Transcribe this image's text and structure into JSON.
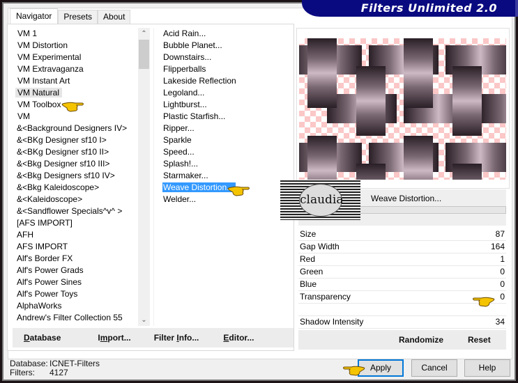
{
  "window": {
    "title": "Filters Unlimited 2.0"
  },
  "tabs": [
    {
      "label": "Navigator",
      "active": true
    },
    {
      "label": "Presets",
      "active": false
    },
    {
      "label": "About",
      "active": false
    }
  ],
  "categories": {
    "selected": "VM Natural",
    "items": [
      "VM 1",
      "VM Distortion",
      "VM Experimental",
      "VM Extravaganza",
      "VM Instant Art",
      "VM Natural",
      "VM Toolbox",
      "VM",
      "&<Background Designers IV>",
      "&<BKg Designer sf10 I>",
      "&<BKg Designer sf10 II>",
      "&<Bkg Designer sf10 III>",
      "&<Bkg Designers sf10 IV>",
      "&<Bkg Kaleidoscope>",
      "&<Kaleidoscope>",
      "&<Sandflower Specials^v^ >",
      "[AFS IMPORT]",
      "AFH",
      "AFS IMPORT",
      "Alf's Border FX",
      "Alf's Power Grads",
      "Alf's Power Sines",
      "Alf's Power Toys",
      "AlphaWorks",
      "Andrew's Filter Collection 55"
    ]
  },
  "filters": {
    "selected": "Weave Distortion...",
    "items": [
      "Acid Rain...",
      "Bubble Planet...",
      "Downstairs...",
      "Flipperballs",
      "Lakeside Reflection",
      "Legoland...",
      "Lightburst...",
      "Plastic Starfish...",
      "Ripper...",
      "Sparkle",
      "Speed...",
      "Splash!...",
      "Starmaker...",
      "Weave Distortion...",
      "Welder..."
    ]
  },
  "nav_buttons": {
    "database": "Database",
    "import": "Import...",
    "filter_info": "Filter Info...",
    "editor": "Editor..."
  },
  "preview": {
    "filter_name": "Weave Distortion...",
    "watermark": "claudia"
  },
  "params": [
    {
      "label": "Size",
      "value": "87"
    },
    {
      "label": "Gap Width",
      "value": "164"
    },
    {
      "label": "Red",
      "value": "1"
    },
    {
      "label": "Green",
      "value": "0"
    },
    {
      "label": "Blue",
      "value": "0"
    },
    {
      "label": "Transparency",
      "value": "0"
    },
    {
      "label": "",
      "value": ""
    },
    {
      "label": "Shadow Intensity",
      "value": "34"
    }
  ],
  "param_buttons": {
    "randomize": "Randomize",
    "reset": "Reset"
  },
  "status": {
    "database_label": "Database:",
    "database_value": "ICNET-Filters",
    "filters_label": "Filters:",
    "filters_value": "4127"
  },
  "dialog_buttons": {
    "apply": "Apply",
    "cancel": "Cancel",
    "help": "Help"
  },
  "colors": {
    "banner": "#0a0a80",
    "selection": "#3399ff",
    "default_button_border": "#0078d7",
    "checker_pink": "#fbc7c7"
  }
}
